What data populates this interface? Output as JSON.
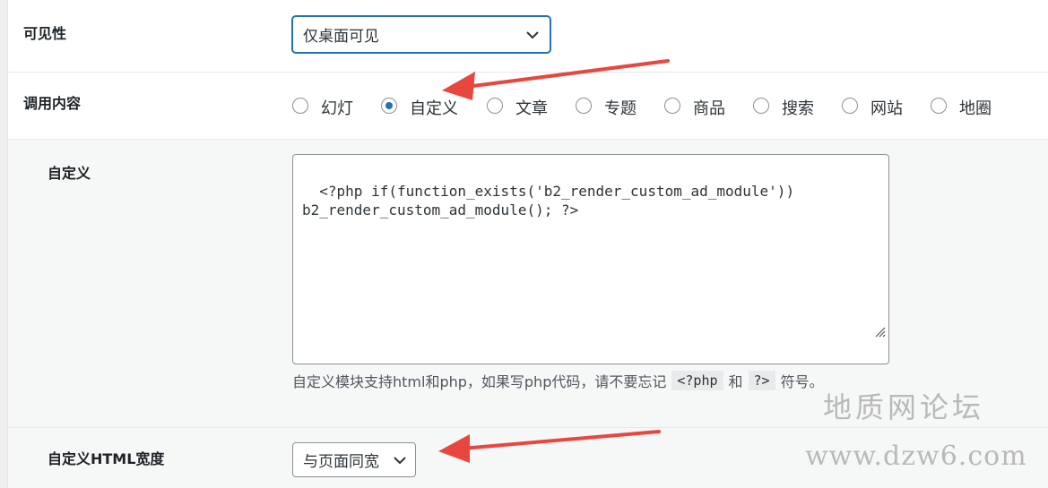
{
  "visibility": {
    "label": "可见性",
    "selected": "仅桌面可见"
  },
  "content_call": {
    "label": "调用内容",
    "options": [
      "幻灯",
      "自定义",
      "文章",
      "专题",
      "商品",
      "搜索",
      "网站",
      "地圈"
    ],
    "selected_index": 1
  },
  "custom": {
    "label": "自定义",
    "code": "<?php if(function_exists('b2_render_custom_ad_module'))\nb2_render_custom_ad_module(); ?>",
    "help_prefix": "自定义模块支持html和php，如果写php代码，请不要忘记",
    "help_code1": "<?php",
    "help_and": "和",
    "help_code2": "?>",
    "help_suffix": "符号。"
  },
  "html_width": {
    "label": "自定义HTML宽度",
    "selected": "与页面同宽"
  },
  "watermark": {
    "title": "地质网论坛",
    "url": "www.dzw6.com"
  },
  "colors": {
    "accent": "#2271b1",
    "arrow": "#e8473f"
  }
}
